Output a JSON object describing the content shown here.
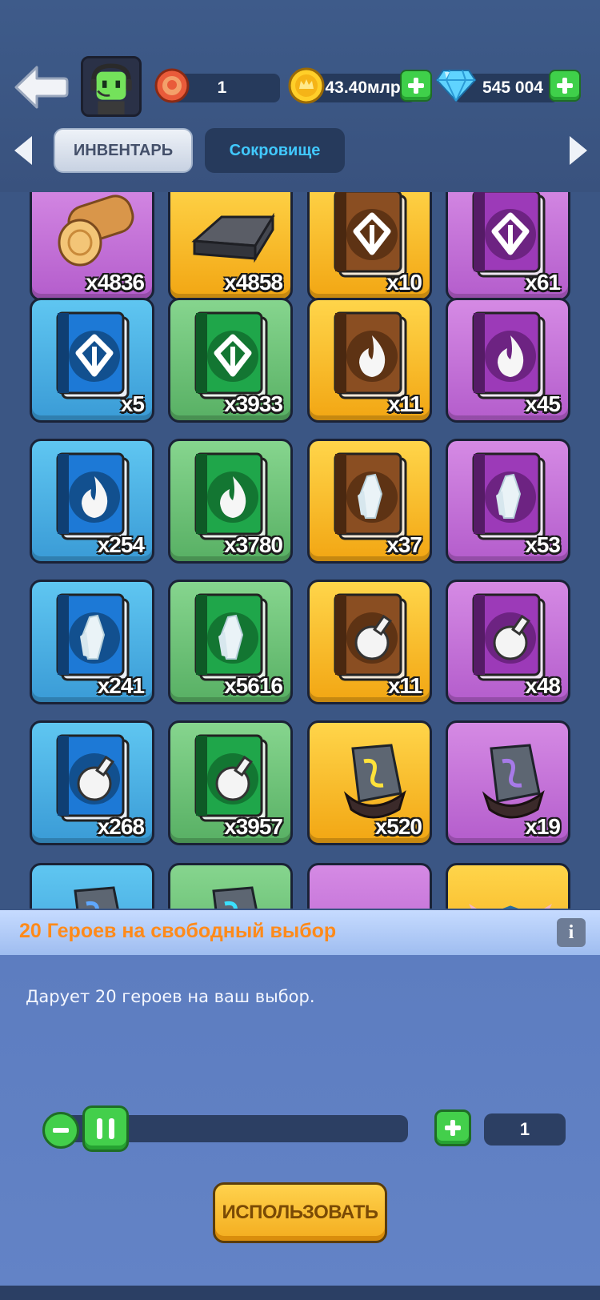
{
  "header": {
    "level_value": "1",
    "gold_value": "43.40млрд",
    "gems_value": "545 004"
  },
  "tabs": [
    {
      "label": "ИНВЕНТАРЬ",
      "active": true
    },
    {
      "label": "Сокровище",
      "active": false
    }
  ],
  "inventory": {
    "items": [
      {
        "art": "log-icon",
        "rarity": "purple",
        "qty": "x4836"
      },
      {
        "art": "iron-ingot-icon",
        "rarity": "gold",
        "qty": "x4858"
      },
      {
        "art": "gold-book-emblem-icon",
        "rarity": "gold",
        "qty": "x10"
      },
      {
        "art": "purple-book-emblem-icon",
        "rarity": "purple",
        "qty": "x61"
      },
      {
        "art": "blue-book-emblem-icon",
        "rarity": "blue",
        "qty": "x5"
      },
      {
        "art": "green-book-emblem-icon",
        "rarity": "green",
        "qty": "x3933"
      },
      {
        "art": "gold-book-flame-icon",
        "rarity": "gold",
        "qty": "x11"
      },
      {
        "art": "purple-book-flame-icon",
        "rarity": "purple",
        "qty": "x45"
      },
      {
        "art": "blue-book-flame-icon",
        "rarity": "blue",
        "qty": "x254"
      },
      {
        "art": "green-book-flame-icon",
        "rarity": "green",
        "qty": "x3780"
      },
      {
        "art": "gold-book-crystal-icon",
        "rarity": "gold",
        "qty": "x37"
      },
      {
        "art": "purple-book-crystal-icon",
        "rarity": "purple",
        "qty": "x53"
      },
      {
        "art": "blue-book-crystal-icon",
        "rarity": "blue",
        "qty": "x241"
      },
      {
        "art": "green-book-crystal-icon",
        "rarity": "green",
        "qty": "x5616"
      },
      {
        "art": "gold-book-potion-icon",
        "rarity": "gold",
        "qty": "x11"
      },
      {
        "art": "purple-book-potion-icon",
        "rarity": "purple",
        "qty": "x48"
      },
      {
        "art": "blue-book-potion-icon",
        "rarity": "blue",
        "qty": "x268"
      },
      {
        "art": "green-book-potion-icon",
        "rarity": "green",
        "qty": "x3957"
      },
      {
        "art": "gold-rune-stone-icon",
        "rarity": "gold",
        "qty": "x520"
      },
      {
        "art": "purple-rune-stone-icon",
        "rarity": "purple",
        "qty": "x19"
      },
      {
        "art": "blue-rune-stone-icon",
        "rarity": "blue",
        "qty": ""
      },
      {
        "art": "green-rune-stone-icon",
        "rarity": "green",
        "qty": ""
      },
      {
        "art": "star-chest-icon",
        "rarity": "purple",
        "qty": ""
      },
      {
        "art": "hero-box-icon",
        "rarity": "gold",
        "qty": ""
      }
    ]
  },
  "detail": {
    "title": "20 Героев на свободный выбор",
    "info_label": "i",
    "description": "Дарует 20 героев на ваш выбор.",
    "quantity": "1",
    "use_label": "ИСПОЛЬЗОВАТЬ"
  },
  "colors": {
    "background": "#3b5684",
    "accent_green": "#43cf4b",
    "title_orange": "#ff8a1a",
    "tab_active_text": "#44506a",
    "tab_inactive_text": "#41c9ff"
  }
}
